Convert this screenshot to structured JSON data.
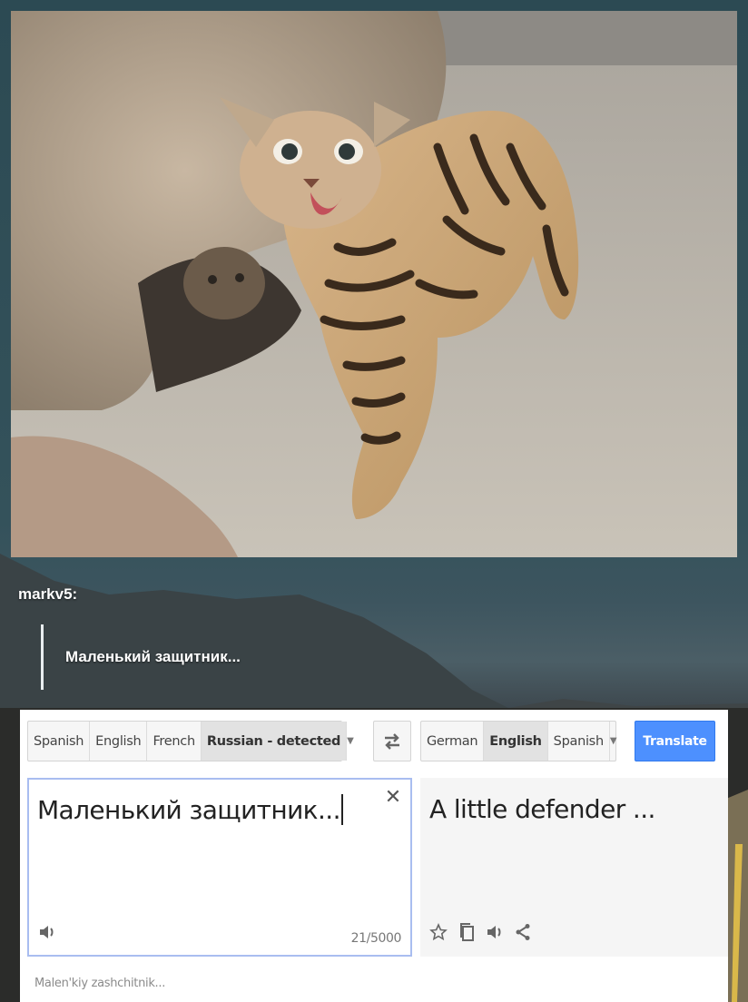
{
  "post": {
    "author": "markv5:",
    "quote": "Маленький защитник..."
  },
  "translate": {
    "source_languages": [
      {
        "label": "Spanish",
        "active": false
      },
      {
        "label": "English",
        "active": false
      },
      {
        "label": "French",
        "active": false
      },
      {
        "label": "Russian - detected",
        "active": true
      }
    ],
    "target_languages": [
      {
        "label": "German",
        "active": false
      },
      {
        "label": "English",
        "active": true
      },
      {
        "label": "Spanish",
        "active": false
      }
    ],
    "translate_button": "Translate",
    "source_text": "Маленький защитник...",
    "character_count": "21/5000",
    "translated_text": "A little defender ...",
    "transliteration": "Malen'kiy zashchitnik...",
    "icons": {
      "swap": "swap-languages-icon",
      "clear": "close-icon",
      "speaker": "speaker-icon",
      "star": "star-icon",
      "copy": "copy-icon",
      "share": "share-icon",
      "dropdown": "chevron-down-icon"
    },
    "colors": {
      "translate_button": "#4d90fe",
      "source_box_border": "#a9bdf0"
    }
  }
}
